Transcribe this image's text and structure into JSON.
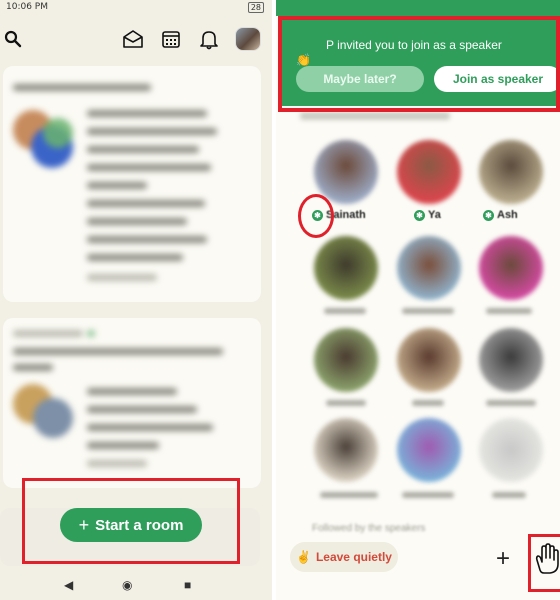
{
  "left_screen": {
    "status_time": "10:06 PM",
    "battery": "28",
    "top_bar": {
      "search_icon": "search-icon",
      "invite_icon": "envelope-icon",
      "calendar_icon": "calendar-icon",
      "notifications_icon": "bell-icon",
      "profile_avatar": "avatar"
    },
    "start_room_label": "Start a room",
    "nav_back": "◀",
    "nav_home": "◉",
    "nav_recents": "■"
  },
  "right_screen": {
    "invite_banner": {
      "message": "P invited you to join as a speaker",
      "maybe_label": "Maybe later?",
      "join_label": "Join as speaker"
    },
    "speakers": [
      {
        "name": "Sainath"
      },
      {
        "name": "Ya"
      },
      {
        "name": "Ash"
      }
    ],
    "followed_label": "Followed by the speakers",
    "leave_label": "Leave quietly",
    "leave_icon": "✌",
    "add_label": "+",
    "raise_hand_icon": "hand-icon"
  },
  "colors": {
    "accent_green": "#2f9e5b",
    "highlight_red": "#e0202a",
    "leave_red": "#d24a3a",
    "bg_cream": "#f2efe4"
  }
}
